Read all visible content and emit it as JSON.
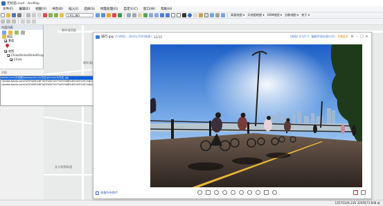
{
  "window": {
    "title": "无标题.mxd - ArcMap"
  },
  "menu": [
    "文件(F)",
    "编辑(E)",
    "视图(V)",
    "书签(B)",
    "插入(I)",
    "选择(S)",
    "地理处理(G)",
    "自定义(C)",
    "窗口(W)",
    "帮助(H)"
  ],
  "toolbar": {
    "scale": "1:93,380",
    "basemap_links": [
      "高德地图 ▾",
      "天地图地图 ▾",
      "OSM地图 ▾",
      "谷歌地图 ▾",
      "关于 ▾"
    ]
  },
  "toc": {
    "header": "内容列表",
    "items": [
      {
        "label": "图层",
        "checked": true
      },
      {
        "label": "景德",
        "checked": true
      },
      {
        "label": "底图",
        "checked": true
      },
      {
        "label": "ChinaOnlineStreetGray",
        "checked": true
      },
      {
        "label": "China",
        "checked": true
      }
    ]
  },
  "results": {
    "title": "识别",
    "lines": [
      "baidu.com/天地图/baidupoi/cc/大东区/picture/大东区.jpg",
      "c/baike.baidu.com/%E5%B0%8F%E5%8C%97%E5%B8%82%E5%9C%BA/0/%E5%B0%8F%E5%8C%97%E5%B8%82%E5%9C%BA",
      "c/baike.baidu.com/%E5%B0%8F%E5%8C%97%E5%B8%82%E5%9C%BA/0/%E5%B0%8F%E5%8C%97%E5%B8%82%E5%9C%BA"
    ]
  },
  "map": {
    "labels": [
      "朝晖诵西屋",
      "朝晖诵西路",
      "长沙梧桐高速"
    ]
  },
  "viewer": {
    "filename": "骑行.jpg",
    "meta": "(530KB，3840x2560像素)",
    "count": "12/15",
    "tag": "[格局] 4:3尺寸",
    "edit_link": "编辑并保存图片(E)",
    "member": "开通会员",
    "all_photos": "查看所有图片"
  },
  "status": {
    "coords": "12570144.226  3265673.608 米"
  }
}
